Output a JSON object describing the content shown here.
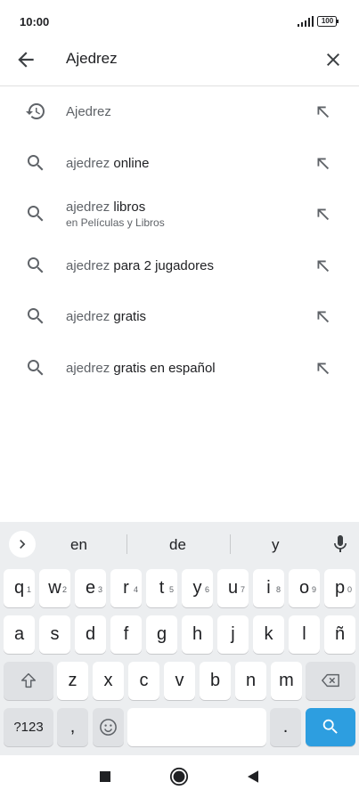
{
  "status": {
    "time": "10:00",
    "battery": "100"
  },
  "search": {
    "query": "Ajedrez"
  },
  "suggestions": [
    {
      "type": "history",
      "prefix": "Ajedrez",
      "bold": "",
      "sub": ""
    },
    {
      "type": "search",
      "prefix": "ajedrez ",
      "bold": "online",
      "sub": ""
    },
    {
      "type": "search",
      "prefix": "ajedrez ",
      "bold": "libros",
      "sub": "en Películas y Libros"
    },
    {
      "type": "search",
      "prefix": "ajedrez ",
      "bold": "para 2 jugadores",
      "sub": ""
    },
    {
      "type": "search",
      "prefix": "ajedrez ",
      "bold": "gratis",
      "sub": ""
    },
    {
      "type": "search",
      "prefix": "ajedrez ",
      "bold": "gratis en español",
      "sub": ""
    }
  ],
  "keyboard": {
    "predictions": [
      "en",
      "de",
      "y"
    ],
    "row1": [
      {
        "k": "q",
        "s": "1"
      },
      {
        "k": "w",
        "s": "2"
      },
      {
        "k": "e",
        "s": "3"
      },
      {
        "k": "r",
        "s": "4"
      },
      {
        "k": "t",
        "s": "5"
      },
      {
        "k": "y",
        "s": "6"
      },
      {
        "k": "u",
        "s": "7"
      },
      {
        "k": "i",
        "s": "8"
      },
      {
        "k": "o",
        "s": "9"
      },
      {
        "k": "p",
        "s": "0"
      }
    ],
    "row2": [
      "a",
      "s",
      "d",
      "f",
      "g",
      "h",
      "j",
      "k",
      "l",
      "ñ"
    ],
    "row3": [
      "z",
      "x",
      "c",
      "v",
      "b",
      "n",
      "m"
    ],
    "symbols_label": "?123",
    "comma": ",",
    "period": "."
  },
  "colors": {
    "accent": "#2d9ee0",
    "icon_gray": "#5f6368",
    "keyboard_bg": "#eceef0"
  }
}
